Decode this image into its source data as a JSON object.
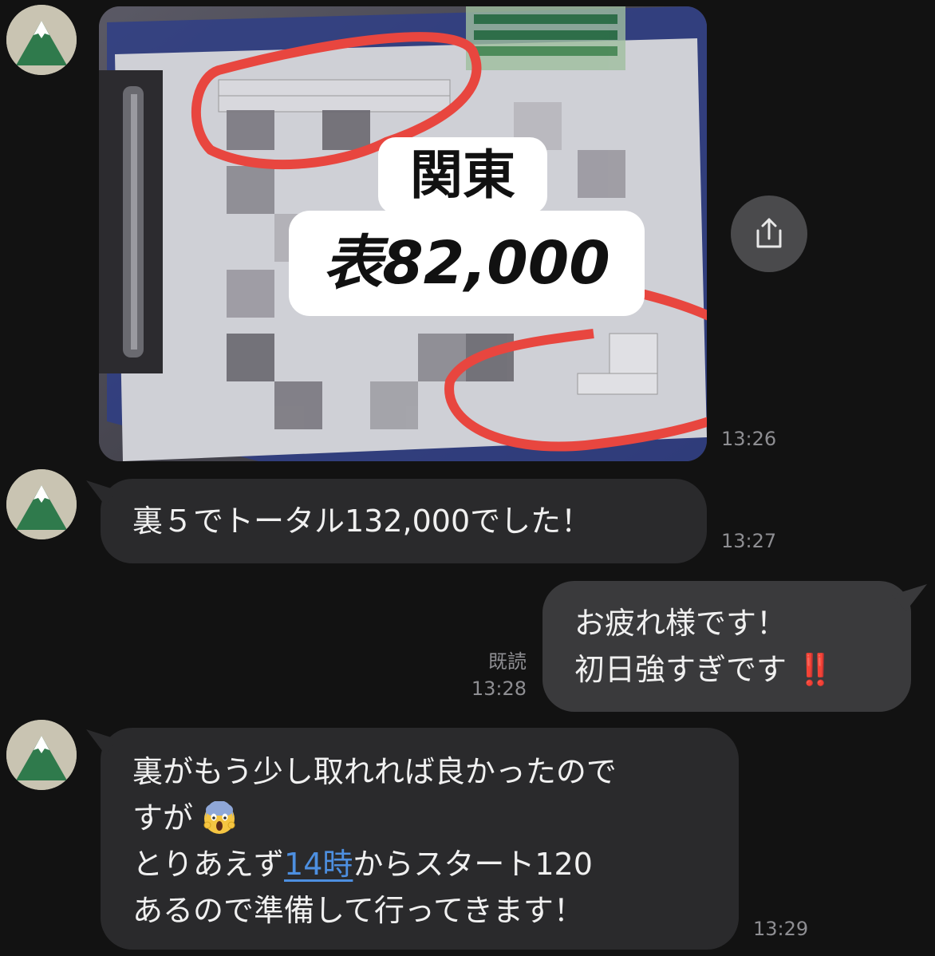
{
  "colors": {
    "background": "#121212",
    "bubble_incoming": "#2a2a2c",
    "bubble_outgoing": "#3a3a3c",
    "link": "#4d8fe0",
    "annotation_red": "#e8463f",
    "timestamp": "#8e8e92"
  },
  "icons": {
    "avatar": "mountain-avatar-icon",
    "share": "share-icon",
    "scared_emoji": "face-screaming-in-fear-emoji",
    "exclamation_emoji": "double-exclamation-emoji"
  },
  "messages": [
    {
      "type": "image",
      "overlay_line1": "関東",
      "overlay_line2": "表82,000",
      "time": "13:26"
    },
    {
      "type": "text",
      "direction": "incoming",
      "text": "裏５でトータル132,000でした！",
      "time": "13:27"
    },
    {
      "type": "text",
      "direction": "outgoing",
      "line1": "お疲れ様です！",
      "line2": "初日強すぎです",
      "line2_emoji": "‼️",
      "read_label": "既読",
      "time": "13:28"
    },
    {
      "type": "text",
      "direction": "incoming",
      "line1": "裏がもう少し取れれば良かったので",
      "line2": "すが",
      "line3_before": "とりあえず",
      "line3_link": "14時",
      "line3_after": "からスタート120",
      "line4": "あるので準備して行ってきます！",
      "time": "13:29"
    }
  ]
}
